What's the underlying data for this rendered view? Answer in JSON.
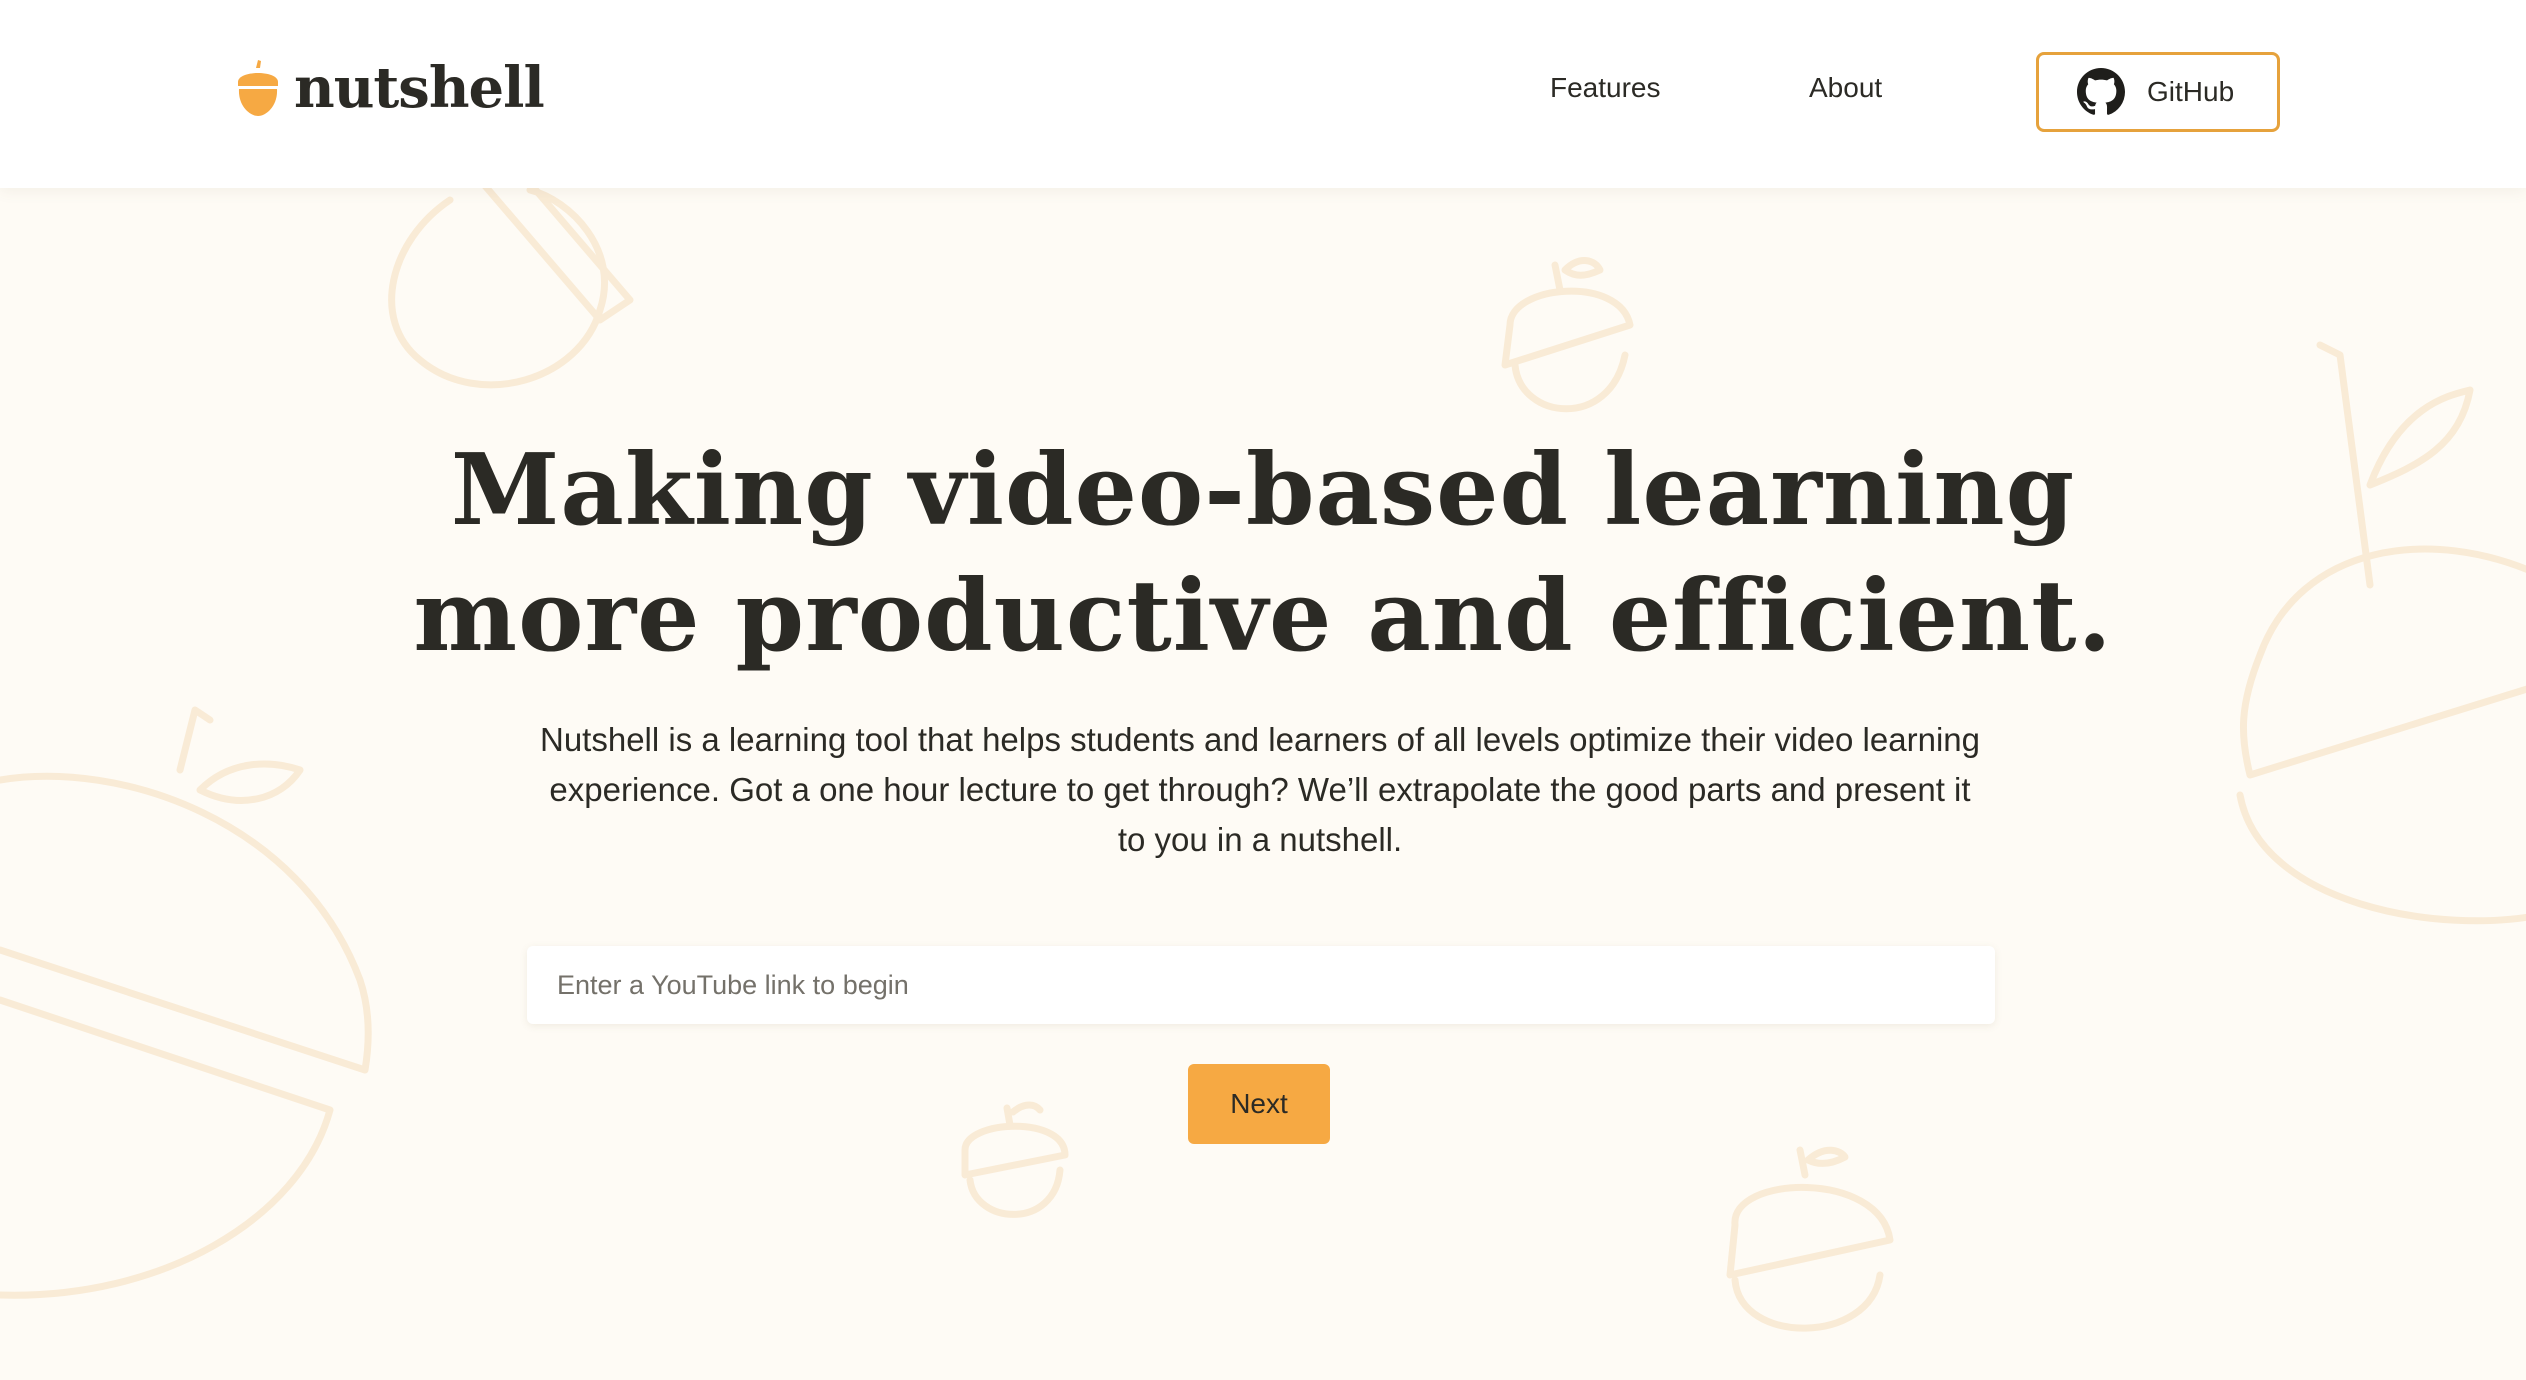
{
  "header": {
    "brand": "nutshell",
    "nav": {
      "features": "Features",
      "about": "About"
    },
    "github_label": "GitHub"
  },
  "hero": {
    "title_line1": "Making video-based learning",
    "title_line2": "more productive and efficient.",
    "description": "Nutshell is a learning tool that helps students and learners of all levels optimize their video learning experience. Got a one hour lecture to get through? We’ll extrapolate the good parts and present it to you in a nutshell.",
    "input_placeholder": "Enter a YouTube link to begin",
    "input_value": "",
    "next_label": "Next"
  },
  "colors": {
    "accent": "#f6a943",
    "accent_border": "#e6a23c",
    "background": "#fefbf5",
    "text": "#2b2a25",
    "decor": "#f9ebd6"
  },
  "icons": [
    "acorn-icon",
    "github-icon",
    "acorn-outline-icon"
  ]
}
